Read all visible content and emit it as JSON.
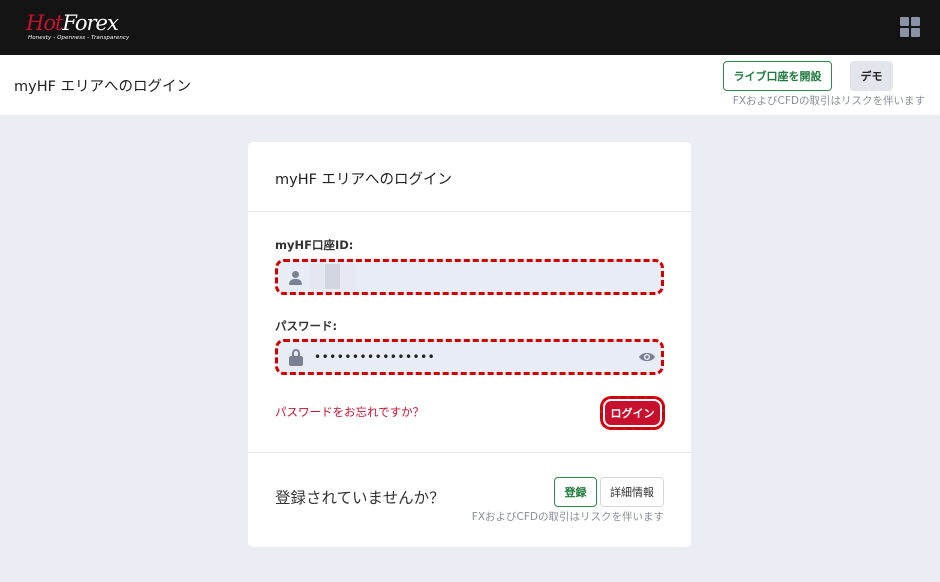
{
  "brand": {
    "logo_hot": "Hot",
    "logo_forex": "Forex",
    "tagline": "Honesty - Openness - Transparency"
  },
  "header": {
    "title": "myHF エリアへのログイン",
    "live_account_label": "ライブ口座を開設",
    "demo_label": "デモ",
    "risk_notice": "FXおよびCFDの取引はリスクを伴います"
  },
  "login_card": {
    "title": "myHF エリアへのログイン",
    "account_id_label": "myHF口座ID:",
    "account_id_value": "",
    "password_label": "パスワード:",
    "password_value": "••••••••••••••••",
    "forgot_password": "パスワードをお忘れですか？",
    "login_button": "ログイン"
  },
  "register": {
    "prompt": "登録されていませんか？",
    "register_button": "登録",
    "details_button": "詳細情報",
    "risk_notice": "FXおよびCFDの取引はリスクを伴います"
  },
  "colors": {
    "brand_red": "#c8102e",
    "green": "#1f7a3d",
    "topbar": "#141414",
    "background": "#ebedf4"
  },
  "icons": [
    "grid-menu-icon",
    "user-icon",
    "lock-icon",
    "eye-icon"
  ]
}
